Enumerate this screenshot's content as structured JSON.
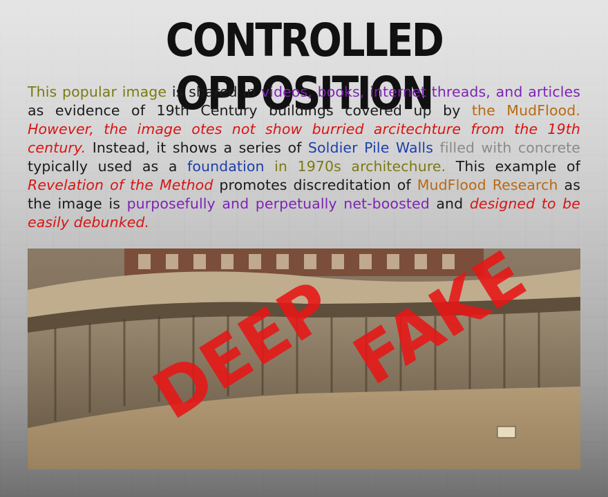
{
  "title": "CONTROLLED OPPOSITION",
  "paragraph": {
    "s1": "This popular image",
    "s2": " is shared in ",
    "s3": "videos, books, internet threads, and articles",
    "s4": " as evidence of 19th Century buildings covered up by ",
    "s5": "the MudFlood.",
    "s6": " ",
    "s7": "However, the image otes not show burried arcitechture from the 19th century.",
    "s8": " Instead, it shows a series of ",
    "s9": "Soldier Pile Walls",
    "s10": " ",
    "s11": "filled with concrete",
    "s12": " typically used as a ",
    "s13": "foundation",
    "s14": " ",
    "s15": "in 1970s architechure.",
    "s16": " This example of ",
    "s17": "Revelation of the Method",
    "s18": " promotes discreditation of ",
    "s19": "MudFlood Research",
    "s20": " as the image is ",
    "s21": "purposefully and perpetually net-boosted",
    "s22": " and ",
    "s23": "designed to be easily debunked."
  },
  "stamp": {
    "word1": "DEEP",
    "word2": "FAKE",
    "color": "#e81616"
  },
  "colors": {
    "olive": "#7a7a12",
    "purple": "#7e22b5",
    "orange": "#b86a12",
    "red": "#d81414",
    "gray": "#8a8a8a",
    "blue": "#1d3ea8"
  }
}
